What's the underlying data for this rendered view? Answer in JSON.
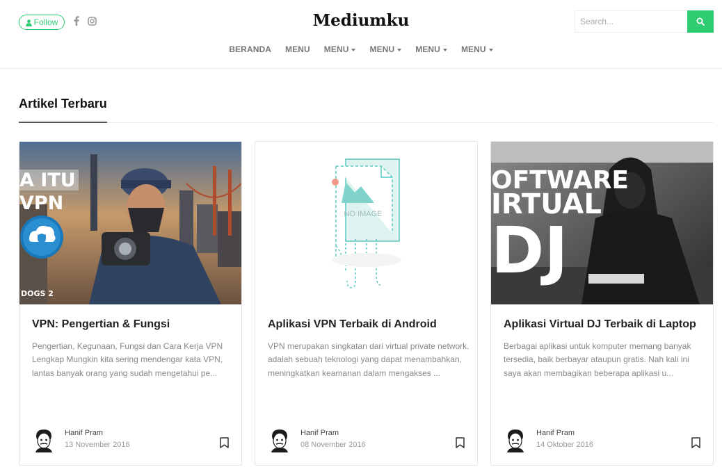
{
  "header": {
    "follow_label": "Follow",
    "site_title": "Mediumku",
    "search_placeholder": "Search...",
    "accent_color": "#2ecc71"
  },
  "nav": {
    "items": [
      {
        "label": "BERANDA",
        "dropdown": false
      },
      {
        "label": "MENU",
        "dropdown": false
      },
      {
        "label": "MENU",
        "dropdown": true
      },
      {
        "label": "MENU",
        "dropdown": true
      },
      {
        "label": "MENU",
        "dropdown": true
      },
      {
        "label": "MENU",
        "dropdown": true
      }
    ]
  },
  "section": {
    "title": "Artikel Terbaru"
  },
  "cards": [
    {
      "image_text": [
        "A ITU",
        "VPN",
        "DOGS 2"
      ],
      "title": "VPN: Pengertian & Fungsi",
      "excerpt": "Pengertian, Kegunaan, Fungsi dan Cara Kerja VPN Lengkap Mungkin kita sering mendengar kata VPN, lantas banyak orang yang sudah mengetahui pe...",
      "author": "Hanif Pram",
      "date": "13 November 2016"
    },
    {
      "image_text": [
        "NO IMAGE"
      ],
      "title": "Aplikasi VPN Terbaik di Android",
      "excerpt": "VPN merupakan singkatan dari virtual private network. adalah sebuah teknologi yang dapat menambahkan, meningkatkan keamanan dalam mengakses ...",
      "author": "Hanif Pram",
      "date": "08 November 2016"
    },
    {
      "image_text": [
        "OFTWARE",
        "IRTUAL",
        "DJ"
      ],
      "title": "Aplikasi Virtual DJ Terbaik di Laptop",
      "excerpt": "Berbagai aplikasi untuk komputer memang banyak tersedia, baik berbayar ataupun gratis. Nah kali ini saya akan membagikan beberapa aplikasi u...",
      "author": "Hanif Pram",
      "date": "14 Oktober 2016"
    }
  ]
}
